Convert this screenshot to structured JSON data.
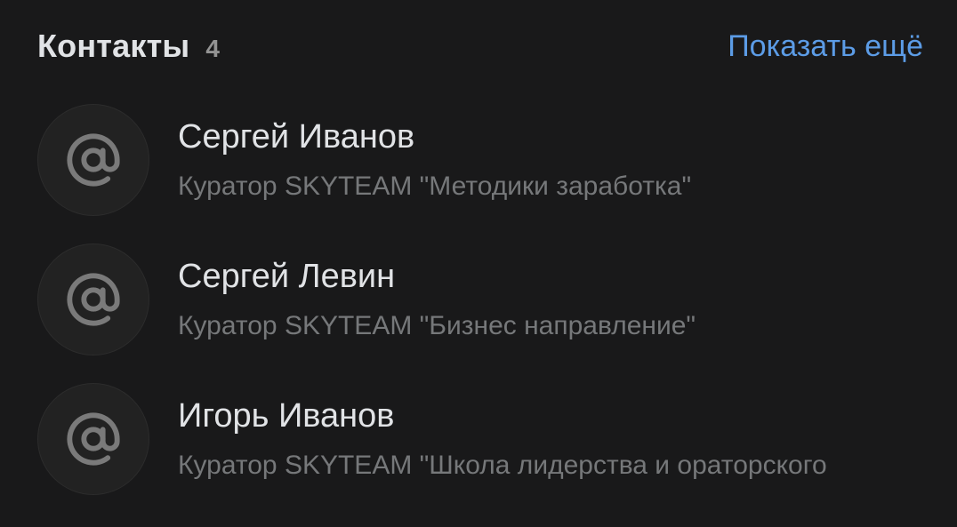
{
  "section": {
    "title": "Контакты",
    "count": "4",
    "show_more_label": "Показать ещё"
  },
  "contacts": [
    {
      "name": "Сергей Иванов",
      "description": "Куратор SKYTEAM \"Методики заработка\"",
      "avatar_icon": "at-sign-icon"
    },
    {
      "name": "Сергей Левин",
      "description": "Куратор SKYTEAM \"Бизнес направление\"",
      "avatar_icon": "at-sign-icon"
    },
    {
      "name": "Игорь Иванов",
      "description": "Куратор SKYTEAM \"Школа лидерства и ораторского",
      "avatar_icon": "at-sign-icon"
    }
  ],
  "colors": {
    "background": "#19191a",
    "text_primary": "#e1e3e6",
    "text_secondary": "#76787a",
    "accent_link": "#5c9ce6",
    "avatar_bg": "#222222",
    "avatar_icon": "#7a7a7a"
  }
}
